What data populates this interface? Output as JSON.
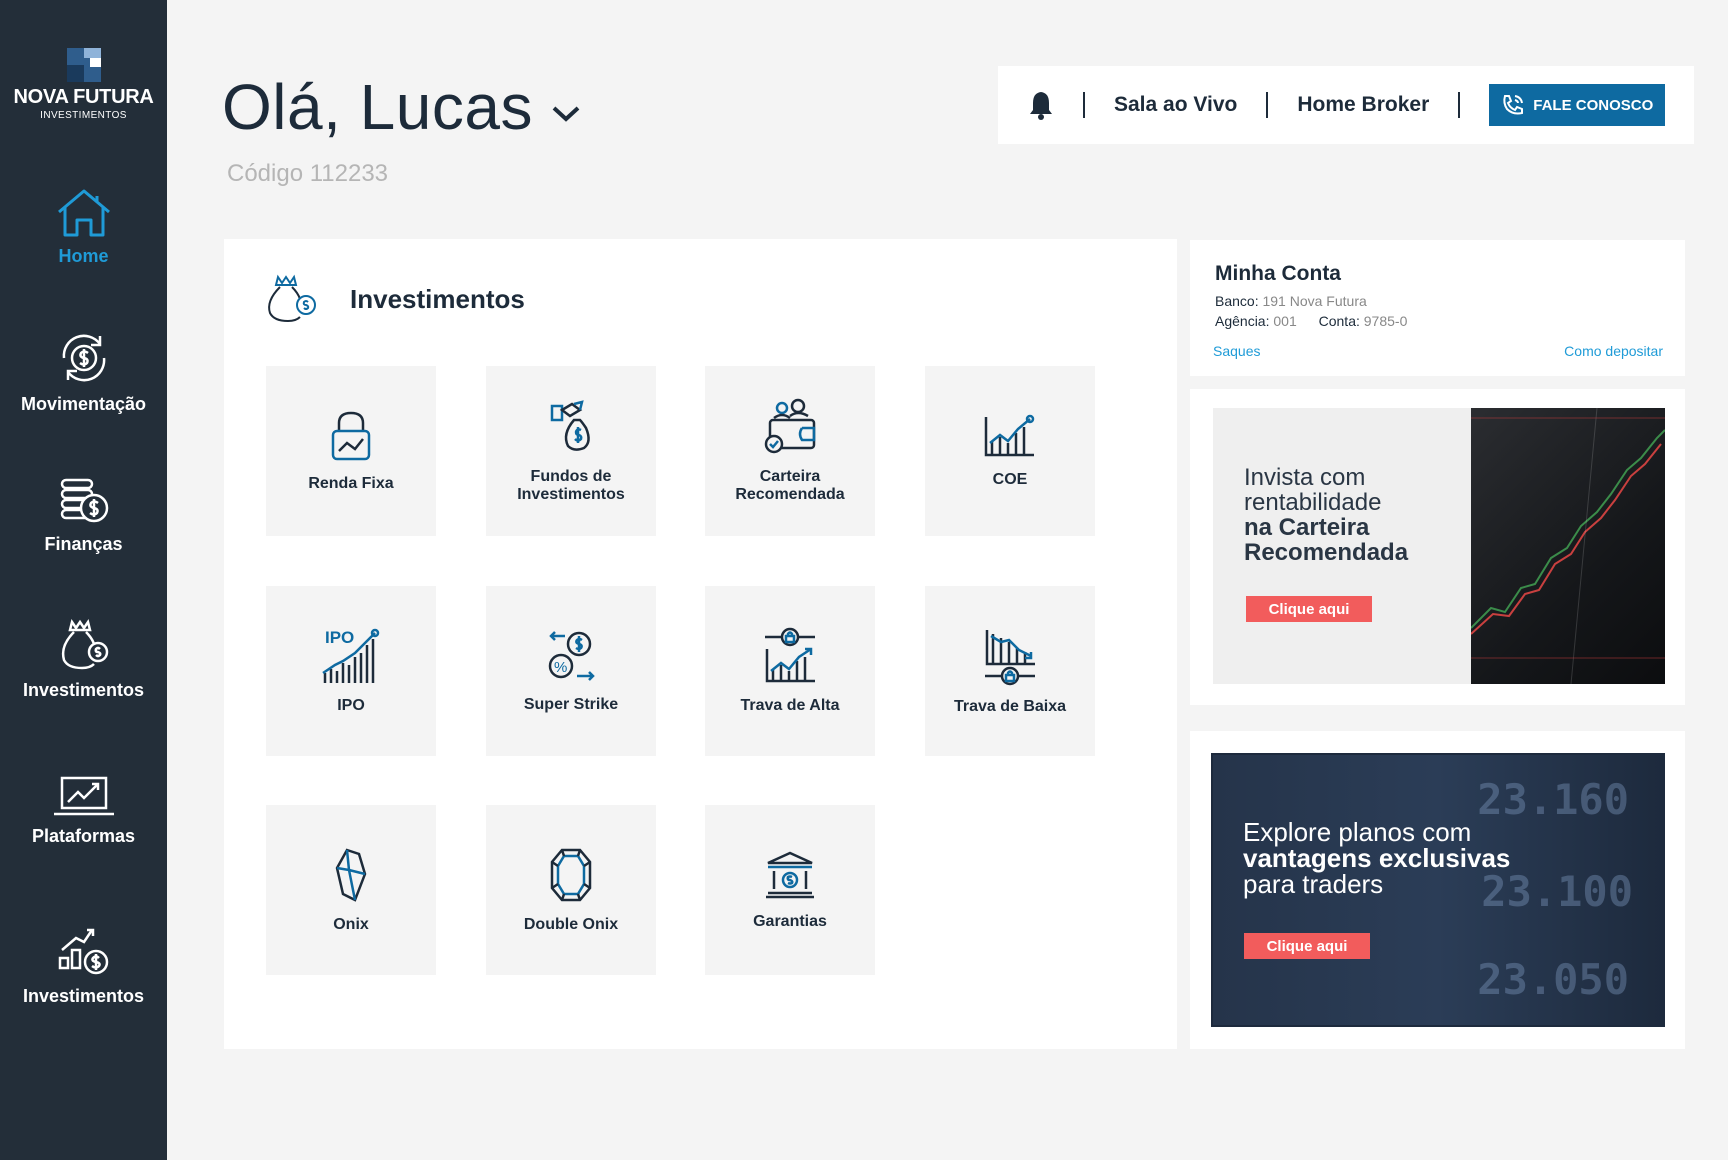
{
  "brand": {
    "name": "NOVA FUTURA",
    "sub": "INVESTIMENTOS"
  },
  "sidebar": {
    "items": [
      {
        "label": "Home",
        "icon": "home-icon",
        "active": true
      },
      {
        "label": "Movimentação",
        "icon": "money-cycle-icon"
      },
      {
        "label": "Finanças",
        "icon": "coins-icon"
      },
      {
        "label": "Investimentos",
        "icon": "money-bag-icon"
      },
      {
        "label": "Plataformas",
        "icon": "laptop-chart-icon"
      },
      {
        "label": "Investimentos",
        "icon": "growth-bars-icon"
      }
    ]
  },
  "header": {
    "greeting": "Olá, Lucas",
    "code": "Código 112233"
  },
  "topbar": {
    "live_room": "Sala ao Vivo",
    "home_broker": "Home Broker",
    "contact": "FALE CONOSCO"
  },
  "investments": {
    "title": "Investimentos",
    "tiles": [
      {
        "label": "Renda Fixa",
        "icon": "lock-chart-icon"
      },
      {
        "label": "Fundos de Investimentos",
        "icon": "fund-bag-icon"
      },
      {
        "label": "Carteira Recomendada",
        "icon": "wallet-people-icon"
      },
      {
        "label": "COE",
        "icon": "bar-chart-up-icon"
      },
      {
        "label": "IPO",
        "icon": "ipo-chart-icon"
      },
      {
        "label": "Super Strike",
        "icon": "strike-arrows-icon"
      },
      {
        "label": "Trava de Alta",
        "icon": "lock-high-icon"
      },
      {
        "label": "Trava de Baixa",
        "icon": "lock-low-icon"
      },
      {
        "label": "Onix",
        "icon": "crystal-icon"
      },
      {
        "label": "Double Onix",
        "icon": "gem-icon"
      },
      {
        "label": "Garantias",
        "icon": "bank-icon"
      }
    ]
  },
  "account": {
    "title": "Minha Conta",
    "bank_label": "Banco:",
    "bank_value": "191 Nova Futura",
    "agency_label": "Agência:",
    "agency_value": "001",
    "account_label": "Conta:",
    "account_value": "9785-0",
    "withdraw": "Saques",
    "deposit": "Como depositar"
  },
  "promo1": {
    "line1": "Invista com",
    "line2": "rentabilidade",
    "line3": "na Carteira",
    "line4": "Recomendada",
    "button": "Clique aqui"
  },
  "promo2": {
    "line1": "Explore planos com",
    "line2": "vantagens exclusivas",
    "line3": "para traders",
    "button": "Clique aqui",
    "bg_numbers": [
      "23.160",
      "23.100",
      "23.050"
    ]
  },
  "colors": {
    "sidebar": "#232e39",
    "accent": "#1f9bd7",
    "button": "#0e6aa1",
    "cta": "#f25c5c",
    "text": "#1d2b3a"
  }
}
